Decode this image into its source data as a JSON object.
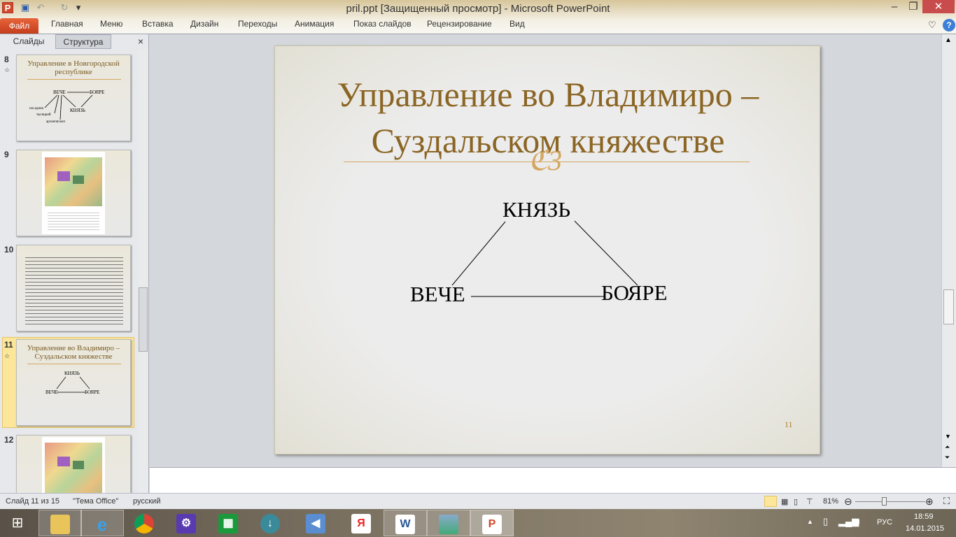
{
  "window": {
    "title": "pril.ppt [Защищенный просмотр]  -  Microsoft PowerPoint",
    "app_icon": "P",
    "qa_icons": [
      "save-icon",
      "undo-icon",
      "redo-icon",
      "customize-icon"
    ]
  },
  "ribbon": {
    "file": "Файл",
    "tabs": [
      "Главная",
      "Меню",
      "Вставка",
      "Дизайн",
      "Переходы",
      "Анимация",
      "Показ слайдов",
      "Рецензирование",
      "Вид"
    ]
  },
  "panel": {
    "tabs": [
      "Слайды",
      "Структура"
    ],
    "close": "×"
  },
  "thumbs": {
    "s8": {
      "num": "8",
      "title": "Управление в Новгородской республике",
      "veche": "ВЕЧЕ",
      "boyare": "БОЯРЕ",
      "knyaz": "КНЯЗЬ",
      "posadnik": "посадник",
      "tysyatsky": "тысяцкий",
      "arkhiepiskop": "архиепископ"
    },
    "s9": {
      "num": "9"
    },
    "s10": {
      "num": "10"
    },
    "s11": {
      "num": "11",
      "title": "Управление во Владимиро – Суздальском княжестве",
      "knyaz": "КНЯЗЬ",
      "veche": "ВЕЧЕ",
      "boyare": "БОЯРЕ"
    },
    "s12": {
      "num": "12"
    }
  },
  "slide": {
    "title": "Управление во Владимиро – Суздальском княжестве",
    "ornament": "ℭ3",
    "knyaz": "КНЯЗЬ",
    "veche": "ВЕЧЕ",
    "boyare": "БОЯРЕ",
    "number": "11"
  },
  "status": {
    "slide": "Слайд 11 из 15",
    "theme": "\"Тема Office\"",
    "lang": "русский",
    "zoom": "81%",
    "zoom_fraction": 0.5
  },
  "taskbar": {
    "apps": [
      "file-explorer",
      "internet-explorer",
      "chrome",
      "settings",
      "store",
      "download-manager",
      "audio",
      "yandex-browser",
      "word",
      "photos",
      "powerpoint"
    ],
    "lang": "РУС",
    "time": "18:59",
    "date": "14.01.2015"
  },
  "colors": {
    "accent": "#d24726",
    "title": "#8b6524",
    "selection": "#fbe69a"
  }
}
